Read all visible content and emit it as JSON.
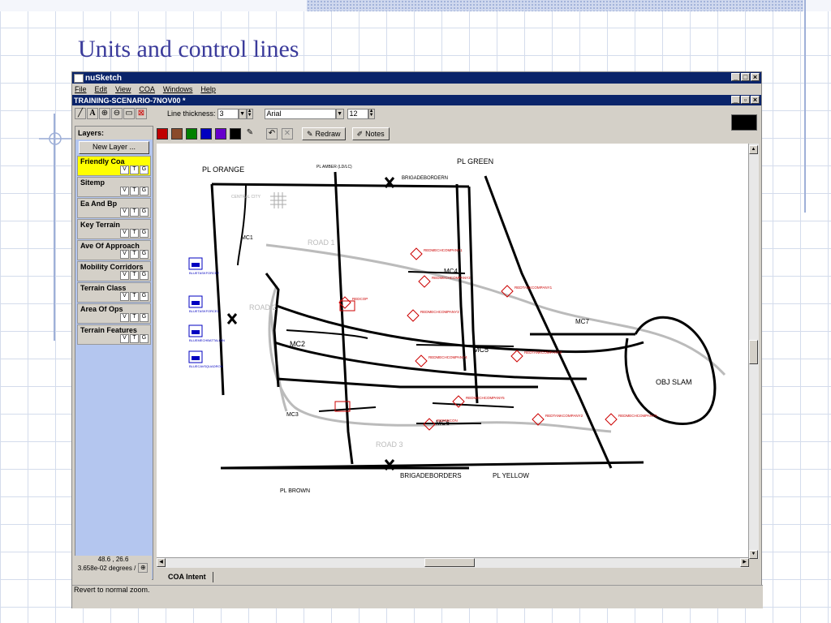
{
  "slide": {
    "title": "Units and control lines"
  },
  "app": {
    "title": "nuSketch",
    "window_controls": [
      "_",
      "□",
      "×"
    ]
  },
  "menu": [
    {
      "label": "File"
    },
    {
      "label": "Edit"
    },
    {
      "label": "View"
    },
    {
      "label": "COA"
    },
    {
      "label": "Windows"
    },
    {
      "label": "Help"
    }
  ],
  "document": {
    "title": "TRAINING-SCENARIO-7NOV00 *",
    "window_controls": [
      "_",
      "▫",
      "×"
    ]
  },
  "toolbar": {
    "line_thickness_label": "Line thickness:",
    "line_thickness_value": "3",
    "font_value": "Arial",
    "font_size_value": "12",
    "redraw_label": "Redraw",
    "notes_label": "Notes"
  },
  "palette_colors": [
    "#c00000",
    "#8a4a2a",
    "#008000",
    "#0000c0",
    "#6600cc",
    "#000000"
  ],
  "layers": {
    "heading": "Layers:",
    "new_layer_label": "New Layer ...",
    "items": [
      {
        "name": "Friendly Coa",
        "active": true
      },
      {
        "name": "Sitemp",
        "active": false
      },
      {
        "name": "Ea And Bp",
        "active": false
      },
      {
        "name": "Key Terrain",
        "active": false
      },
      {
        "name": "Ave Of Approach",
        "active": false
      },
      {
        "name": "Mobility Corridors",
        "active": false
      },
      {
        "name": "Terrain Class",
        "active": false
      },
      {
        "name": "Area Of Ops",
        "active": false
      },
      {
        "name": "Terrain Features",
        "active": false
      }
    ],
    "toggle_letters": [
      "V",
      "T",
      "G"
    ]
  },
  "coords": {
    "xy": "48.6  ,  26.6",
    "scale": "3.658e-02 degrees /"
  },
  "tabs": [
    {
      "label": "COA Intent"
    }
  ],
  "status": {
    "text": "Revert to normal zoom."
  },
  "map": {
    "labels": {
      "pl_orange": "PL ORANGE",
      "pl_amber": "PL AMBER (LD/LC)",
      "brigadeborder_n": "BRIGADEBORDERN",
      "pl_green": "PL GREEN",
      "central": "CENTRAL CITY",
      "road1": "ROAD 1",
      "road2": "ROAD 2",
      "road3": "ROAD 3",
      "mc1": "MC1",
      "mc2": "MC2",
      "mc3": "MC3",
      "mc4": "MC4",
      "mc5": "MC5",
      "mc6": "MC6",
      "mc7": "MC7",
      "obj_slam": "OBJ SLAM",
      "brigadeborders": "BRIGADEBORDERS",
      "pl_yellow": "PL YELLOW",
      "pl_brown": "PL BROWN"
    },
    "red_units": [
      "REDMECHCOMPANY1",
      "REDMECHCOMPANY2",
      "REDTANKCOMPANY1",
      "REDMECHCOMPANY3",
      "REDTANKCOMPANYZ",
      "REDMECHCOMPANY4",
      "REDMECHCOMPANY5",
      "REDTANKCOMPANY2",
      "REDRECON",
      "REDMECHCOMPANY6",
      "REDCOP"
    ],
    "blue_units": [
      "BLUETASKFORCE2",
      "BLUETASKFORCE1",
      "BLUEMECHBATTALION",
      "BLUECAVSQUADRON"
    ]
  }
}
